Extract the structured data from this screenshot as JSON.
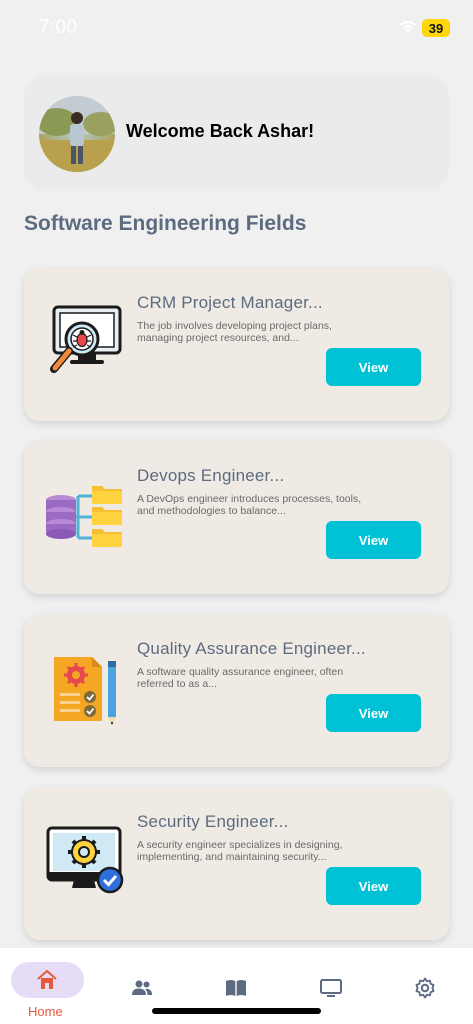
{
  "status_bar": {
    "time": "7:00",
    "battery": "39",
    "wifi_icon": "wifi-icon"
  },
  "welcome": {
    "text": "Welcome Back Ashar!",
    "avatar": "user-avatar"
  },
  "section_title": "Software Engineering Fields",
  "fields": [
    {
      "title": "CRM Project Manager...",
      "description": "The job involves developing project plans, managing project resources, and...",
      "button": "View",
      "icon": "bug-search-monitor-icon"
    },
    {
      "title": "Devops Engineer...",
      "description": "A DevOps engineer introduces processes, tools, and methodologies to balance...",
      "button": "View",
      "icon": "database-folders-icon"
    },
    {
      "title": "Quality Assurance Engineer...",
      "description": "A software quality assurance engineer, often referred to as a...",
      "button": "View",
      "icon": "qa-checklist-icon"
    },
    {
      "title": "Security Engineer...",
      "description": "A security engineer specializes in designing, implementing, and maintaining security...",
      "button": "View",
      "icon": "secure-settings-monitor-icon"
    }
  ],
  "bottom_nav": {
    "items": [
      {
        "label": "Home",
        "icon": "home-icon",
        "active": true
      },
      {
        "label": "",
        "icon": "people-icon",
        "active": false
      },
      {
        "label": "",
        "icon": "book-icon",
        "active": false
      },
      {
        "label": "",
        "icon": "monitor-icon",
        "active": false
      },
      {
        "label": "",
        "icon": "gear-icon",
        "active": false
      }
    ]
  },
  "colors": {
    "background": "#f0f0f0",
    "card": "#efebe4",
    "accent_button": "#00c2d6",
    "title_text": "#5d6b80",
    "home_active": "#e55a3c",
    "home_pill": "#e6dcf6"
  }
}
